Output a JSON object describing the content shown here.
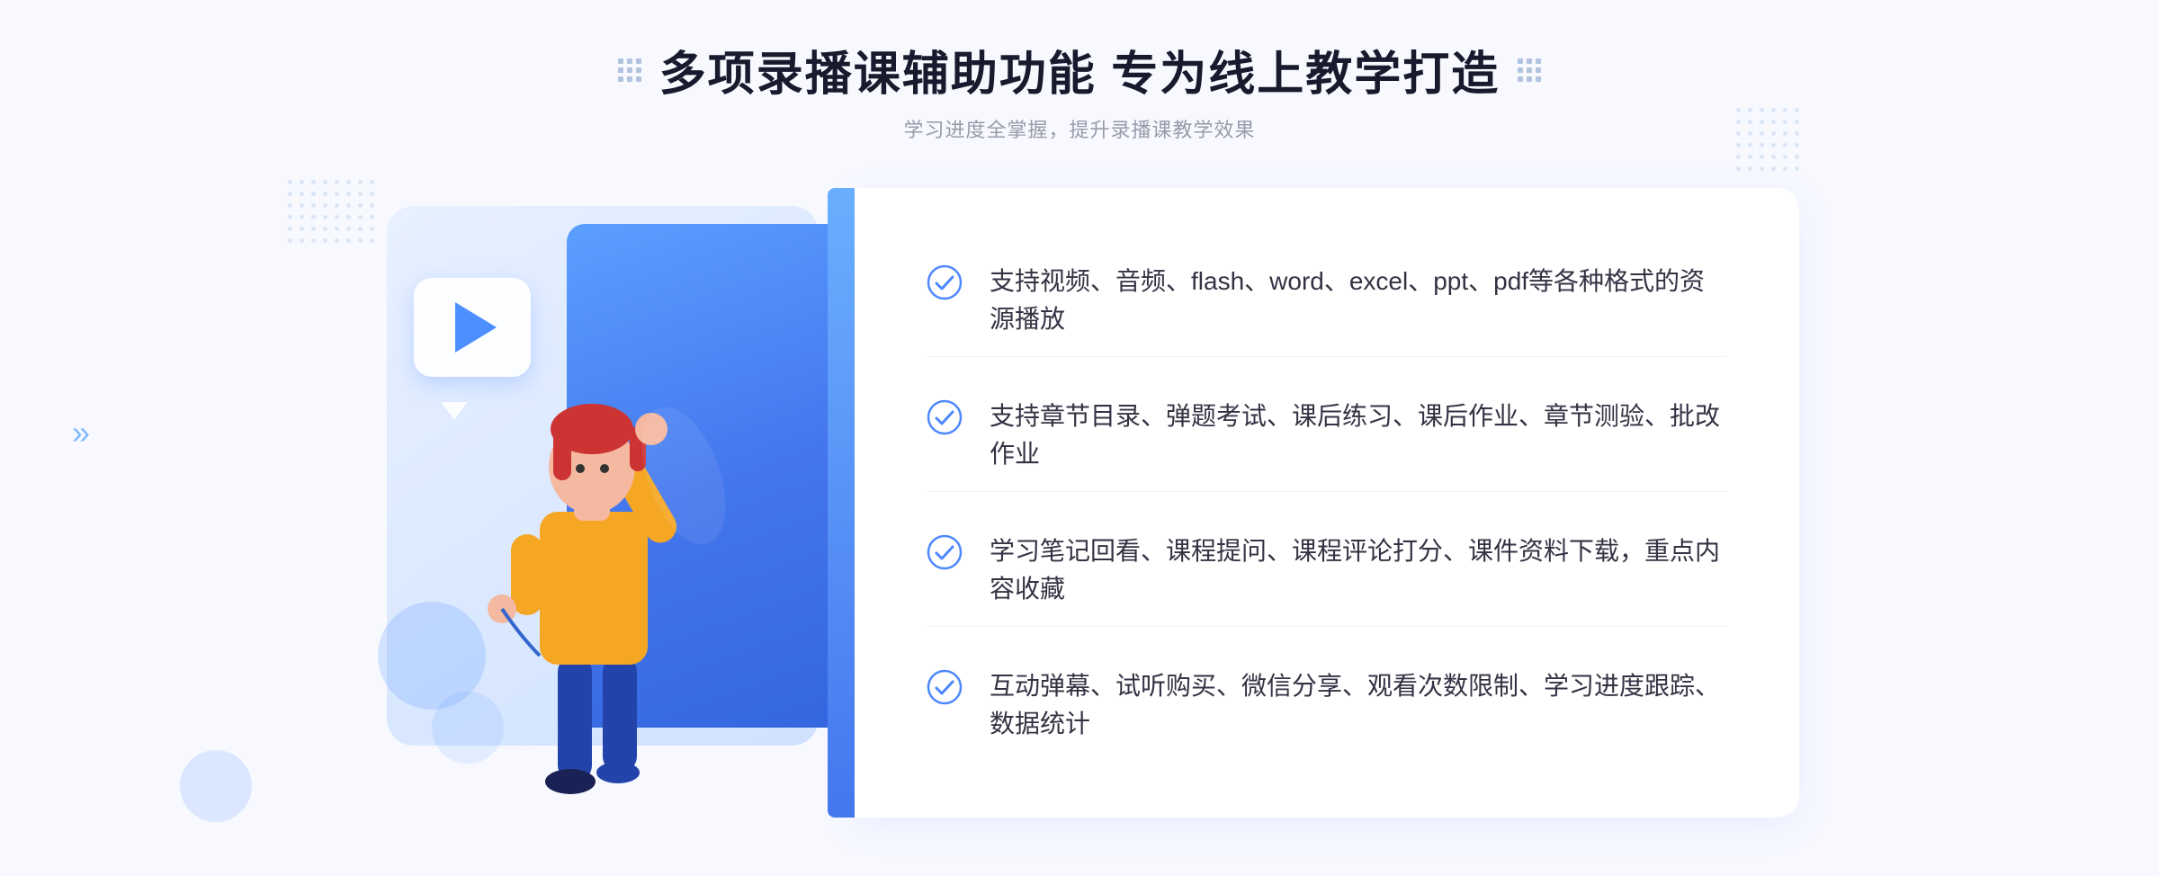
{
  "header": {
    "title": "多项录播课辅助功能 专为线上教学打造",
    "subtitle": "学习进度全掌握，提升录播课教学效果"
  },
  "features": [
    {
      "id": 1,
      "text": "支持视频、音频、flash、word、excel、ppt、pdf等各种格式的资源播放"
    },
    {
      "id": 2,
      "text": "支持章节目录、弹题考试、课后练习、课后作业、章节测验、批改作业"
    },
    {
      "id": 3,
      "text": "学习笔记回看、课程提问、课程评论打分、课件资料下载，重点内容收藏"
    },
    {
      "id": 4,
      "text": "互动弹幕、试听购买、微信分享、观看次数限制、学习进度跟踪、数据统计"
    }
  ],
  "colors": {
    "accent_blue": "#4d88ff",
    "light_blue": "#6aabff",
    "title_color": "#1a1a2e",
    "text_color": "#333344",
    "subtitle_color": "#999aaa"
  },
  "icons": {
    "check": "check-circle-icon",
    "play": "play-icon",
    "chevron": "chevron-right-icon"
  }
}
